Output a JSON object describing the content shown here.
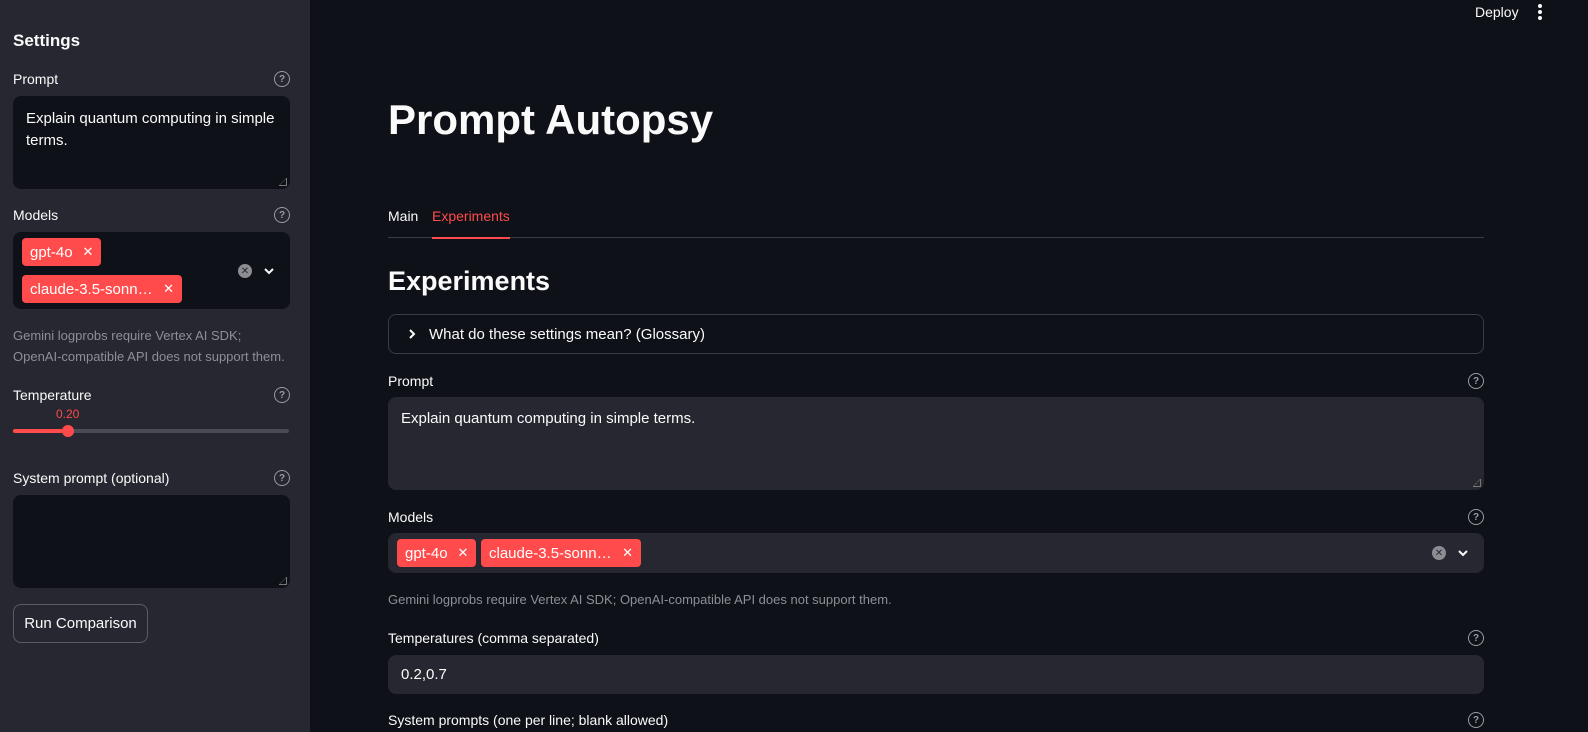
{
  "header": {
    "deploy_label": "Deploy"
  },
  "sidebar": {
    "title": "Settings",
    "prompt_label": "Prompt",
    "prompt_value": "Explain quantum computing in simple terms.",
    "models_label": "Models",
    "models": [
      "gpt-4o",
      "claude-3.5-sonn…"
    ],
    "models_caption": "Gemini logprobs require Vertex AI SDK; OpenAI-compatible API does not support them.",
    "temperature_label": "Temperature",
    "temperature_value": "0.20",
    "temperature_fraction": 0.2,
    "system_prompt_label": "System prompt (optional)",
    "system_prompt_value": "",
    "run_button": "Run Comparison"
  },
  "main": {
    "title": "Prompt Autopsy",
    "tabs": [
      {
        "label": "Main",
        "active": false
      },
      {
        "label": "Experiments",
        "active": true
      }
    ],
    "section_title": "Experiments",
    "glossary_label": "What do these settings mean? (Glossary)",
    "prompt_label": "Prompt",
    "prompt_value": "Explain quantum computing in simple terms.",
    "models_label": "Models",
    "models": [
      "gpt-4o",
      "claude-3.5-sonn…"
    ],
    "models_caption": "Gemini logprobs require Vertex AI SDK; OpenAI-compatible API does not support them.",
    "temperatures_label": "Temperatures (comma separated)",
    "temperatures_value": "0.2,0.7",
    "system_prompts_label": "System prompts (one per line; blank allowed)"
  },
  "colors": {
    "accent": "#ff4b4b",
    "sidebar_bg": "#262730",
    "main_bg": "#0e1117"
  },
  "icons": [
    "help-icon",
    "clear-icon",
    "chevron-down-icon",
    "chevron-right-icon",
    "kebab-menu-icon",
    "close-icon"
  ]
}
